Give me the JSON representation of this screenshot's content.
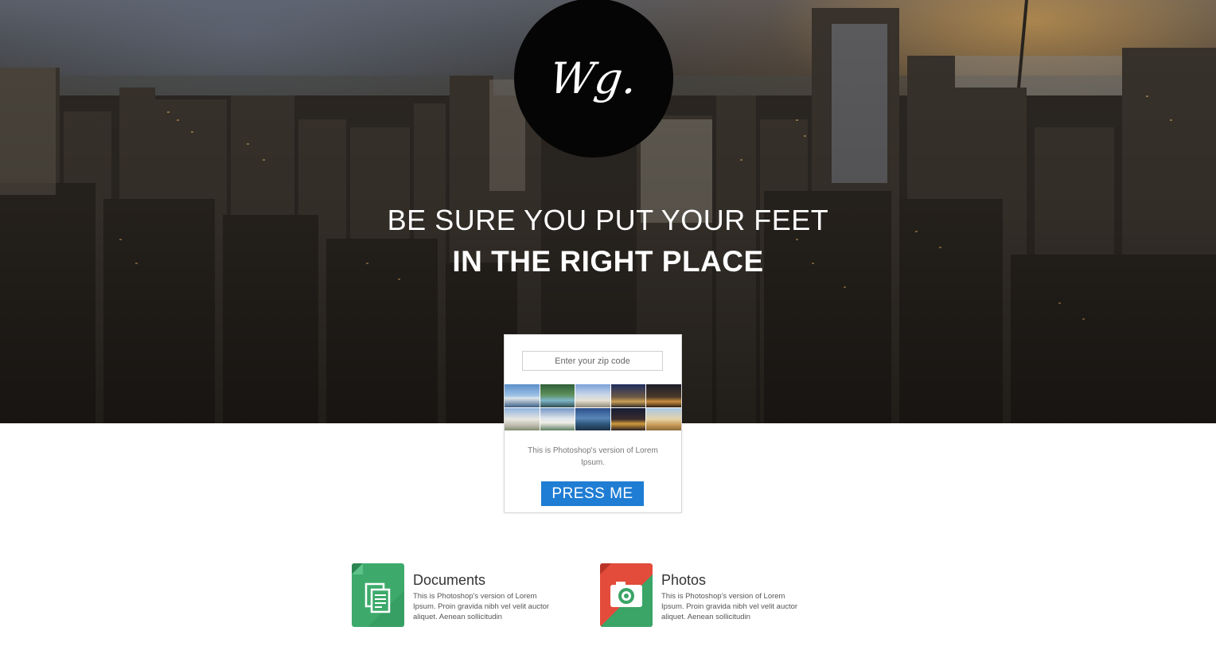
{
  "logo": {
    "text": "Wg."
  },
  "hero": {
    "line1": "BE SURE YOU PUT YOUR FEET",
    "line2": "IN THE RIGHT PLACE"
  },
  "card": {
    "zip_placeholder": "Enter your zip code",
    "zip_value": "",
    "description": "This is Photoshop's version of Lorem Ipsum.",
    "button_label": "PRESS ME"
  },
  "thumbnails": [
    {
      "name": "sydney-opera-house"
    },
    {
      "name": "waterfall-lake"
    },
    {
      "name": "basilica"
    },
    {
      "name": "colosseum"
    },
    {
      "name": "pyramid-night"
    },
    {
      "name": "leaning-tower-pisa"
    },
    {
      "name": "taj-mahal"
    },
    {
      "name": "coastal-city"
    },
    {
      "name": "eiffel-tower"
    },
    {
      "name": "pyramids-giza"
    }
  ],
  "features": [
    {
      "title": "Documents",
      "description": "This is Photoshop's version of Lorem Ipsum. Proin gravida nibh vel velit auctor aliquet. Aenean sollicitudin",
      "icon": "documents-icon",
      "color": "#3daa6b"
    },
    {
      "title": "Photos",
      "description": "This is Photoshop's version of Lorem Ipsum. Proin gravida nibh vel velit auctor aliquet. Aenean sollicitudin",
      "icon": "camera-icon",
      "color": "#e34b3a"
    }
  ],
  "colors": {
    "button": "#1f7dd4",
    "logo_bg": "#050505"
  }
}
